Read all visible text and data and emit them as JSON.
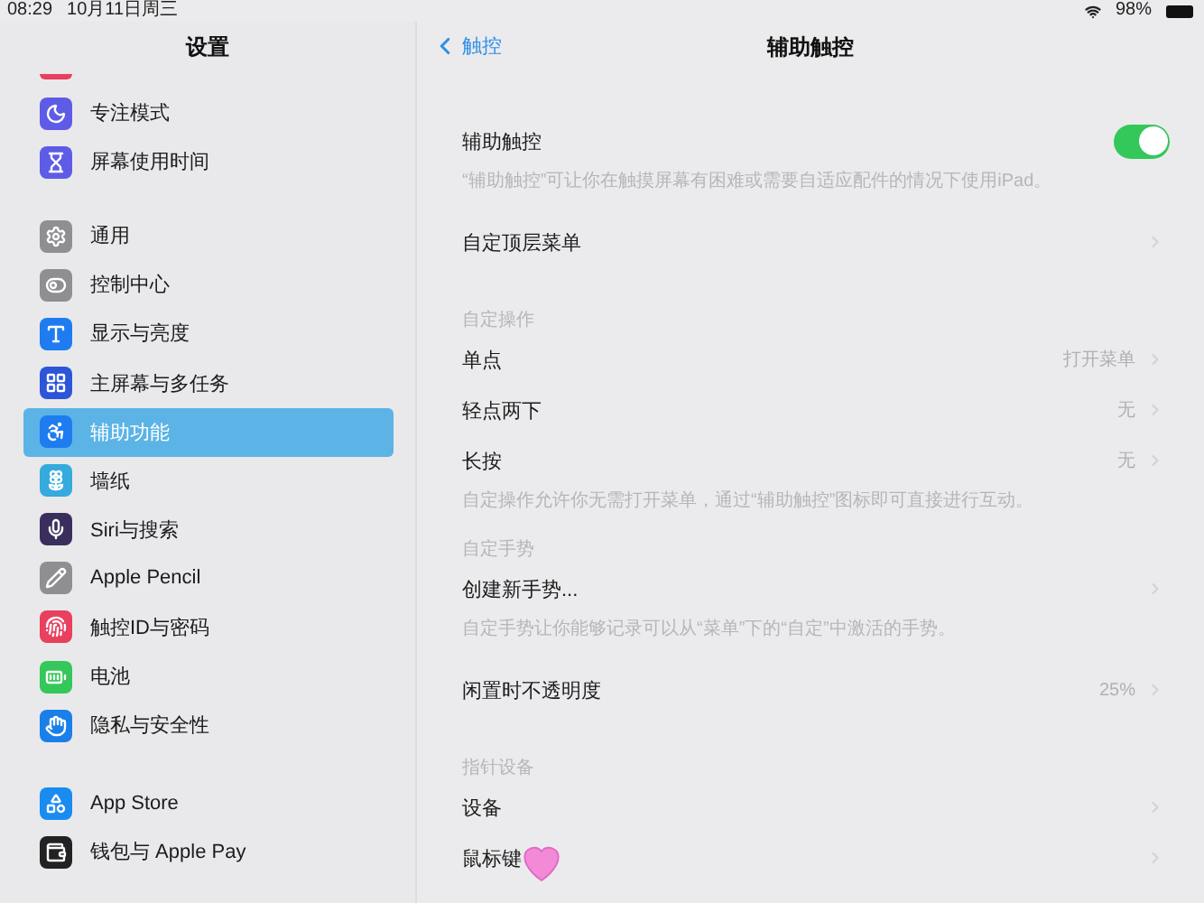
{
  "status_bar": {
    "time": "08:29",
    "date": "10月11日周三",
    "battery": "98%"
  },
  "sidebar": {
    "title": "设置",
    "groups": [
      [
        {
          "label": "专注模式",
          "color": "#5e5ce6",
          "selected": false
        },
        {
          "label": "屏幕使用时间",
          "color": "#5e5ce6",
          "selected": false
        }
      ],
      [
        {
          "label": "通用",
          "color": "#8e8e93",
          "selected": false
        },
        {
          "label": "控制中心",
          "color": "#8e8e93",
          "selected": false
        },
        {
          "label": "显示与亮度",
          "color": "#1e7cf0",
          "selected": false
        },
        {
          "label": "主屏幕与多任务",
          "color": "#2c55d8",
          "selected": false
        },
        {
          "label": "辅助功能",
          "color": "#1e7cf0",
          "selected": true
        },
        {
          "label": "墙纸",
          "color": "#35aadc",
          "selected": false
        },
        {
          "label": "Siri与搜索",
          "color": "#3a2f5c",
          "selected": false
        },
        {
          "label": "Apple Pencil",
          "color": "#8e8e93",
          "selected": false
        },
        {
          "label": "触控ID与密码",
          "color": "#e8405e",
          "selected": false
        },
        {
          "label": "电池",
          "color": "#34c759",
          "selected": false
        },
        {
          "label": "隐私与安全性",
          "color": "#1a7fe8",
          "selected": false
        }
      ],
      [
        {
          "label": "App Store",
          "color": "#1a8cf0",
          "selected": false
        },
        {
          "label": "钱包与 Apple Pay",
          "color": "#222222",
          "selected": false
        }
      ]
    ]
  },
  "detail": {
    "back": "触控",
    "title": "辅助触控",
    "items": [
      {
        "kind": "toggle",
        "label": "辅助触控",
        "on": true
      },
      {
        "kind": "note",
        "text": "“辅助触控”可让你在触摸屏幕有困难或需要自适应配件的情况下使用iPad。"
      },
      {
        "kind": "link",
        "label": "自定顶层菜单"
      },
      {
        "kind": "header",
        "text": "自定操作"
      },
      {
        "kind": "link",
        "label": "单点",
        "value": "打开菜单"
      },
      {
        "kind": "link",
        "label": "轻点两下",
        "value": "无"
      },
      {
        "kind": "link",
        "label": "长按",
        "value": "无"
      },
      {
        "kind": "note",
        "text": "自定操作允许你无需打开菜单，通过“辅助触控”图标即可直接进行互动。"
      },
      {
        "kind": "header",
        "text": "自定手势"
      },
      {
        "kind": "link",
        "label": "创建新手势..."
      },
      {
        "kind": "note",
        "text": "自定手势让你能够记录可以从“菜单”下的“自定”中激活的手势。"
      },
      {
        "kind": "link",
        "label": "闲置时不透明度",
        "value": "25%"
      },
      {
        "kind": "header",
        "text": "指针设备"
      },
      {
        "kind": "link",
        "label": "设备"
      },
      {
        "kind": "link",
        "label": "鼠标键"
      }
    ]
  }
}
